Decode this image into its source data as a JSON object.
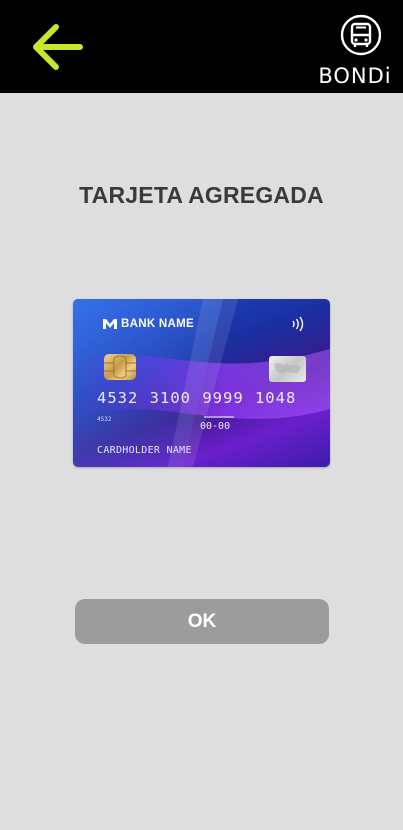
{
  "header": {
    "back_icon": "arrow-left-icon",
    "back_color": "#c8e62a",
    "brand_icon": "bus-icon",
    "brand_label": "BONDi"
  },
  "main": {
    "title": "TARJETA AGREGADA"
  },
  "card": {
    "bank_name": "BANK NAME",
    "number": "4532 3100 9999 1048",
    "small_number": "4532",
    "expiry": "00-00",
    "holder": "CARDHOLDER NAME",
    "contactless_icon": "contactless-icon",
    "chip_icon": "chip-icon"
  },
  "actions": {
    "ok_label": "OK"
  },
  "colors": {
    "background": "#dedede",
    "topbar": "#000000",
    "button": "#9c9c9c",
    "title": "#3a3a3a"
  }
}
